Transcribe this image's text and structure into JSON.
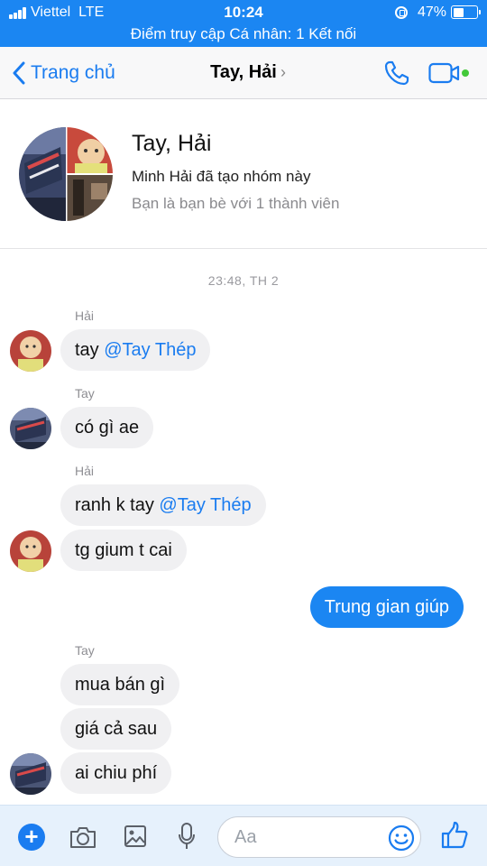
{
  "status_bar": {
    "carrier": "Viettel",
    "network": "LTE",
    "time": "10:24",
    "battery": "47%",
    "battery_level": 0.47,
    "hotspot": "Điểm truy cập Cá nhân: 1 Kết nối"
  },
  "nav": {
    "back_label": "Trang chủ",
    "title": "Tay, Hải",
    "title_chevron": "›"
  },
  "group": {
    "name": "Tay, Hải",
    "created_by": "Minh Hải đã tạo nhóm này",
    "friends_info": "Bạn là bạn bè với 1 thành viên"
  },
  "chat": {
    "timestamp": "23:48, TH 2",
    "messages": [
      {
        "sender": "Hải",
        "text": "tay ",
        "mention": "@Tay Thép"
      },
      {
        "sender": "Tay",
        "text": "có gì ae"
      },
      {
        "sender": "Hải",
        "text": "ranh k tay ",
        "mention": "@Tay Thép"
      },
      {
        "text": "tg gium t cai"
      },
      {
        "from_me": true,
        "text": "Trung gian giúp"
      },
      {
        "sender": "Tay",
        "text": "mua bán gì"
      },
      {
        "text": "giá cả sau"
      },
      {
        "text": "ai chiu phí"
      }
    ]
  },
  "composer": {
    "placeholder": "Aa",
    "icons": [
      "plus-icon",
      "camera-icon",
      "image-icon",
      "microphone-icon",
      "emoji-icon",
      "thumbs-up-icon"
    ]
  },
  "colors": {
    "accent": "#1b86f2",
    "link": "#1a7cf0",
    "bubble_other": "#f0f0f2",
    "online": "#44c93a"
  }
}
